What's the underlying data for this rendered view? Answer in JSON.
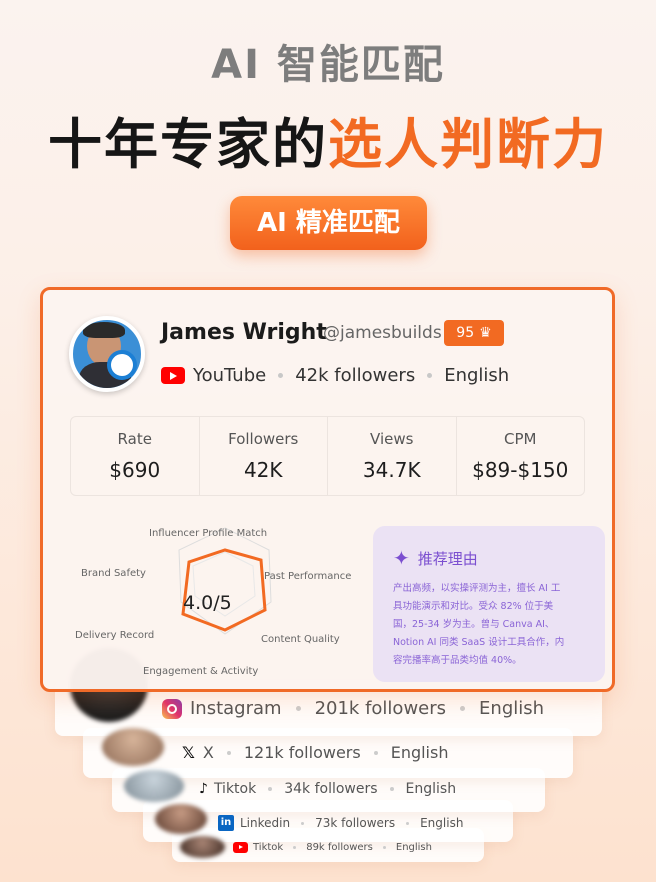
{
  "header": {
    "kicker": "AI 智能匹配",
    "headline_main": "十年专家的",
    "headline_highlight": "选人判断力",
    "pill": "AI 精准匹配"
  },
  "main_card": {
    "name": "James Wright",
    "handle": "@jamesbuilds",
    "score": "95",
    "platform": "YouTube",
    "followers_text": "42k followers",
    "language": "English",
    "stats": [
      {
        "label": "Rate",
        "value": "$690"
      },
      {
        "label": "Followers",
        "value": "42K"
      },
      {
        "label": "Views",
        "value": "34.7K"
      },
      {
        "label": "CPM",
        "value": "$89-$150"
      }
    ],
    "radar": {
      "labels": [
        "Influencer Profile Match",
        "Brand Safety",
        "Past Performance",
        "Delivery Record",
        "Content Quality",
        "Engagement & Activity"
      ],
      "score": "4.0/5"
    },
    "reason": {
      "title": "推荐理由",
      "lines": [
        "产出高频，以实操评测为主，擅长 AI 工",
        "具功能演示和对比。受众 82% 位于美",
        "国，25-34 岁为主。曾与 Canva AI、",
        "Notion AI 同类 SaaS 设计工具合作，内",
        "容完播率高于品类均值 40%。"
      ]
    }
  },
  "stack_cards": [
    {
      "platform": "Instagram",
      "followers": "201k followers",
      "language": "English"
    },
    {
      "platform": "X",
      "followers": "121k followers",
      "language": "English"
    },
    {
      "platform": "Tiktok",
      "followers": "34k followers",
      "language": "English"
    },
    {
      "platform": "Linkedin",
      "followers": "73k followers",
      "language": "English"
    },
    {
      "platform": "Tiktok",
      "followers": "89k followers",
      "language": "English"
    }
  ],
  "colors": {
    "accent": "#f26a22",
    "reason_bg": "#ebe2f4",
    "reason_text": "#8a64d6"
  }
}
